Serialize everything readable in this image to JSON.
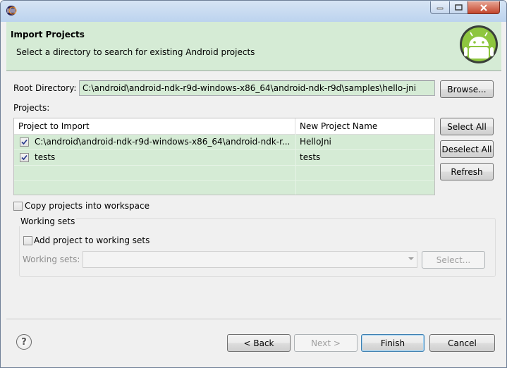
{
  "dialog": {
    "header_title": "Import Projects",
    "header_message": "Select a directory to search for existing Android projects"
  },
  "root": {
    "label": "Root Directory:",
    "value": "C:\\android\\android-ndk-r9d-windows-x86_64\\android-ndk-r9d\\samples\\hello-jni",
    "browse_label": "Browse..."
  },
  "projects": {
    "label": "Projects:",
    "columns": [
      "Project to Import",
      "New Project Name"
    ],
    "rows": [
      {
        "path": "C:\\android\\android-ndk-r9d-windows-x86_64\\android-ndk-r...",
        "name": "HelloJni",
        "checked": true
      },
      {
        "path": "tests",
        "name": "tests",
        "checked": true
      }
    ],
    "select_all": "Select All",
    "deselect_all": "Deselect All",
    "refresh": "Refresh"
  },
  "copy_option": {
    "label": "Copy projects into workspace",
    "checked": false
  },
  "working_sets": {
    "group_label": "Working sets",
    "add_label": "Add project to working sets",
    "add_checked": false,
    "sets_label": "Working sets:",
    "sets_value": "",
    "select_label": "Select..."
  },
  "footer": {
    "help_symbol": "?",
    "back_label": "< Back",
    "next_label": "Next >",
    "finish_label": "Finish",
    "cancel_label": "Cancel"
  },
  "colors": {
    "accent_green": "#d5ebd5"
  }
}
